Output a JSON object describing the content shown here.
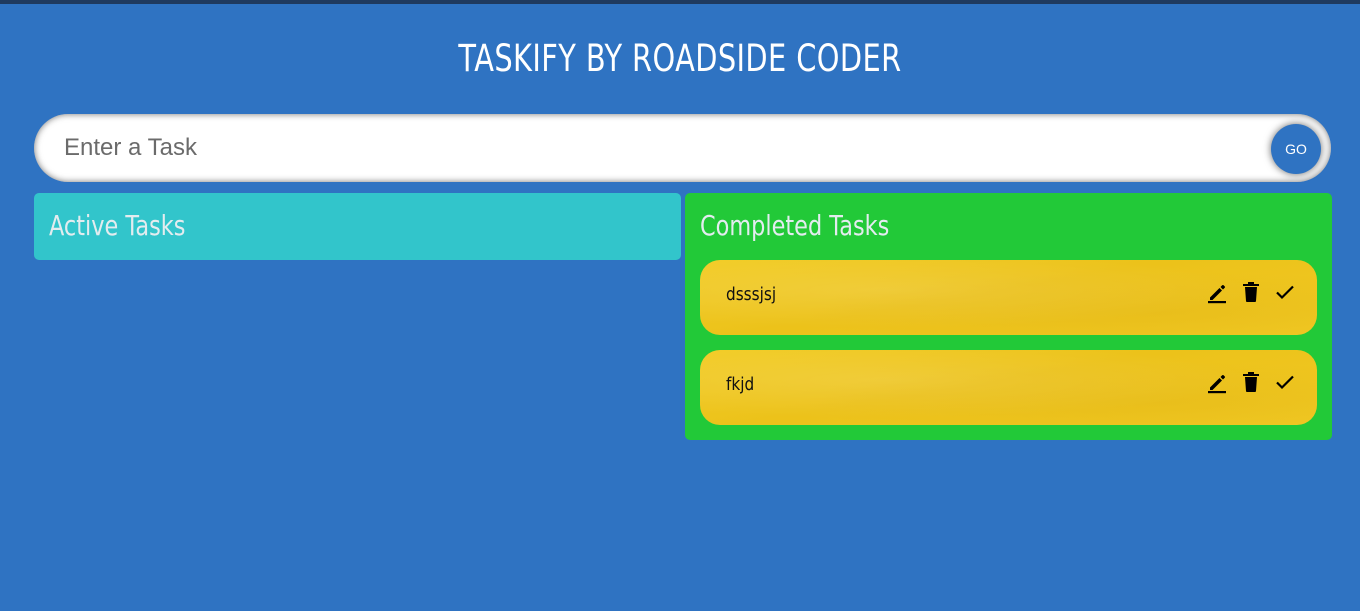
{
  "app": {
    "title": "TASKIFY BY ROADSIDE CODER"
  },
  "input": {
    "placeholder": "Enter a Task",
    "value": "",
    "go_label": "GO"
  },
  "panels": {
    "active": {
      "heading": "Active Tasks",
      "color": "#32c5cb",
      "tasks": []
    },
    "completed": {
      "heading": "Completed Tasks",
      "color": "#22c938",
      "tasks": [
        {
          "text": "dsssjsj",
          "icons": [
            "edit-icon",
            "delete-icon",
            "done-icon"
          ]
        },
        {
          "text": "fkjd",
          "icons": [
            "edit-icon",
            "delete-icon",
            "done-icon"
          ]
        }
      ]
    }
  },
  "colors": {
    "background": "#2f73c2",
    "card": "#f0c820"
  }
}
